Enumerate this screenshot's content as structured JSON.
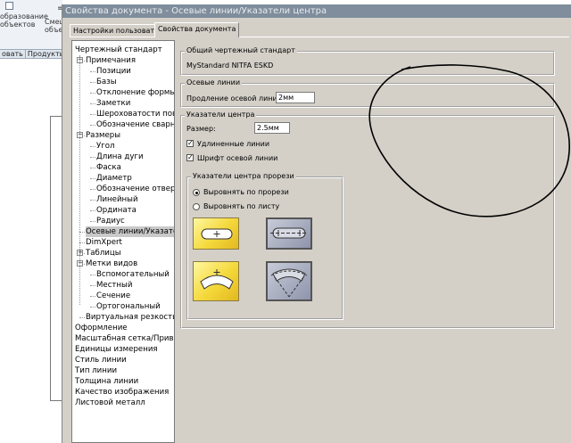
{
  "background_app": {
    "toolbar_label_1": "образование\nобъектов",
    "toolbar_label_2": "Смещ\nобъе",
    "tab_left": "овать",
    "tab_right": "Продукть"
  },
  "dialog": {
    "title": "Свойства документа - Осевые линии/Указатели центра",
    "tabs": [
      {
        "label": "Настройки пользователя"
      },
      {
        "label": "Свойства документа"
      }
    ]
  },
  "tree": {
    "items": [
      {
        "label": "Чертежный стандарт"
      },
      {
        "label": "Примечания"
      },
      {
        "label": "Позиции"
      },
      {
        "label": "Базы"
      },
      {
        "label": "Отклонение формы"
      },
      {
        "label": "Заметки"
      },
      {
        "label": "Шероховатости повер"
      },
      {
        "label": "Обозначение сварног"
      },
      {
        "label": "Размеры"
      },
      {
        "label": "Угол"
      },
      {
        "label": "Длина дуги"
      },
      {
        "label": "Фаска"
      },
      {
        "label": "Диаметр"
      },
      {
        "label": "Обозначение отверст"
      },
      {
        "label": "Линейный"
      },
      {
        "label": "Ордината"
      },
      {
        "label": "Радиус"
      },
      {
        "label": "Осевые линии/Указатели"
      },
      {
        "label": "DimXpert"
      },
      {
        "label": "Таблицы"
      },
      {
        "label": "Метки видов"
      },
      {
        "label": "Вспомогательный"
      },
      {
        "label": "Местный"
      },
      {
        "label": "Сечение"
      },
      {
        "label": "Ортогональный"
      },
      {
        "label": "Виртуальная резкость"
      },
      {
        "label": "Оформление"
      },
      {
        "label": "Масштабная сетка/Привязат"
      },
      {
        "label": "Единицы измерения"
      },
      {
        "label": "Стиль линии"
      },
      {
        "label": "Тип линии"
      },
      {
        "label": "Толщина линии"
      },
      {
        "label": "Качество изображения"
      },
      {
        "label": "Листовой металл"
      }
    ],
    "expanders": [
      "−",
      "−",
      "+",
      "−"
    ]
  },
  "panel": {
    "standard_group": "Общий чертежный стандарт",
    "standard_value": "MyStandard NITFA ESKD",
    "centerlines_group": "Осевые линии",
    "extension_label": "Продление осевой линии:",
    "extension_value": "2мм",
    "centermarks_group": "Указатели центра",
    "size_label": "Размер:",
    "size_value": "2.5мм",
    "extended_lines_label": "Удлиненные линии",
    "extended_lines_checked": "✓",
    "font_label": "Шрифт осевой линии",
    "font_checked": "✓",
    "slot_group": "Указатели центра прорези",
    "align_slot_label": "Выровнять по прорези",
    "align_sheet_label": "Выровнять по листу"
  },
  "colors": {
    "title_bar": "#7f8d9c",
    "dialog_bg": "#d4d0c8",
    "tile_yellow": "#f4d83a",
    "tile_selected": "#8e94ac"
  }
}
